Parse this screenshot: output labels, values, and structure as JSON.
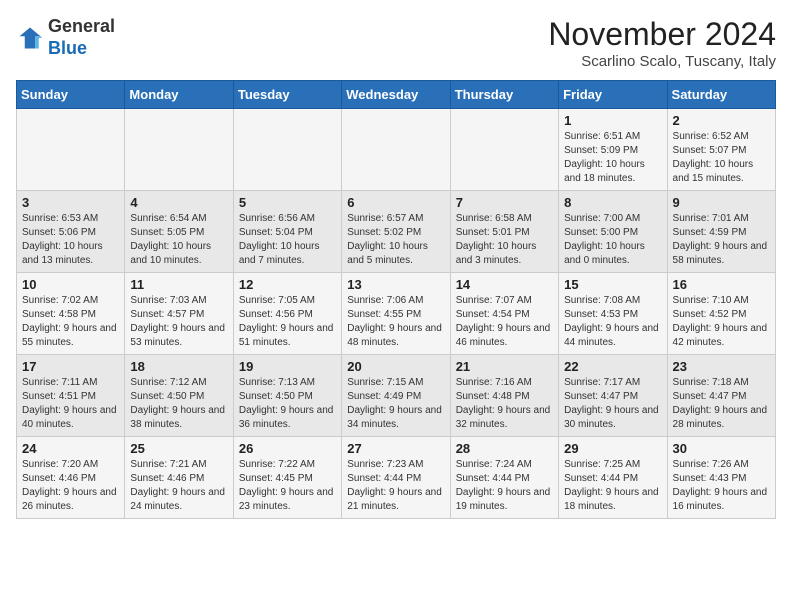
{
  "logo": {
    "general": "General",
    "blue": "Blue"
  },
  "title": "November 2024",
  "location": "Scarlino Scalo, Tuscany, Italy",
  "days_of_week": [
    "Sunday",
    "Monday",
    "Tuesday",
    "Wednesday",
    "Thursday",
    "Friday",
    "Saturday"
  ],
  "weeks": [
    [
      {
        "day": "",
        "sunrise": "",
        "sunset": "",
        "daylight": ""
      },
      {
        "day": "",
        "sunrise": "",
        "sunset": "",
        "daylight": ""
      },
      {
        "day": "",
        "sunrise": "",
        "sunset": "",
        "daylight": ""
      },
      {
        "day": "",
        "sunrise": "",
        "sunset": "",
        "daylight": ""
      },
      {
        "day": "",
        "sunrise": "",
        "sunset": "",
        "daylight": ""
      },
      {
        "day": "1",
        "sunrise": "Sunrise: 6:51 AM",
        "sunset": "Sunset: 5:09 PM",
        "daylight": "Daylight: 10 hours and 18 minutes."
      },
      {
        "day": "2",
        "sunrise": "Sunrise: 6:52 AM",
        "sunset": "Sunset: 5:07 PM",
        "daylight": "Daylight: 10 hours and 15 minutes."
      }
    ],
    [
      {
        "day": "3",
        "sunrise": "Sunrise: 6:53 AM",
        "sunset": "Sunset: 5:06 PM",
        "daylight": "Daylight: 10 hours and 13 minutes."
      },
      {
        "day": "4",
        "sunrise": "Sunrise: 6:54 AM",
        "sunset": "Sunset: 5:05 PM",
        "daylight": "Daylight: 10 hours and 10 minutes."
      },
      {
        "day": "5",
        "sunrise": "Sunrise: 6:56 AM",
        "sunset": "Sunset: 5:04 PM",
        "daylight": "Daylight: 10 hours and 7 minutes."
      },
      {
        "day": "6",
        "sunrise": "Sunrise: 6:57 AM",
        "sunset": "Sunset: 5:02 PM",
        "daylight": "Daylight: 10 hours and 5 minutes."
      },
      {
        "day": "7",
        "sunrise": "Sunrise: 6:58 AM",
        "sunset": "Sunset: 5:01 PM",
        "daylight": "Daylight: 10 hours and 3 minutes."
      },
      {
        "day": "8",
        "sunrise": "Sunrise: 7:00 AM",
        "sunset": "Sunset: 5:00 PM",
        "daylight": "Daylight: 10 hours and 0 minutes."
      },
      {
        "day": "9",
        "sunrise": "Sunrise: 7:01 AM",
        "sunset": "Sunset: 4:59 PM",
        "daylight": "Daylight: 9 hours and 58 minutes."
      }
    ],
    [
      {
        "day": "10",
        "sunrise": "Sunrise: 7:02 AM",
        "sunset": "Sunset: 4:58 PM",
        "daylight": "Daylight: 9 hours and 55 minutes."
      },
      {
        "day": "11",
        "sunrise": "Sunrise: 7:03 AM",
        "sunset": "Sunset: 4:57 PM",
        "daylight": "Daylight: 9 hours and 53 minutes."
      },
      {
        "day": "12",
        "sunrise": "Sunrise: 7:05 AM",
        "sunset": "Sunset: 4:56 PM",
        "daylight": "Daylight: 9 hours and 51 minutes."
      },
      {
        "day": "13",
        "sunrise": "Sunrise: 7:06 AM",
        "sunset": "Sunset: 4:55 PM",
        "daylight": "Daylight: 9 hours and 48 minutes."
      },
      {
        "day": "14",
        "sunrise": "Sunrise: 7:07 AM",
        "sunset": "Sunset: 4:54 PM",
        "daylight": "Daylight: 9 hours and 46 minutes."
      },
      {
        "day": "15",
        "sunrise": "Sunrise: 7:08 AM",
        "sunset": "Sunset: 4:53 PM",
        "daylight": "Daylight: 9 hours and 44 minutes."
      },
      {
        "day": "16",
        "sunrise": "Sunrise: 7:10 AM",
        "sunset": "Sunset: 4:52 PM",
        "daylight": "Daylight: 9 hours and 42 minutes."
      }
    ],
    [
      {
        "day": "17",
        "sunrise": "Sunrise: 7:11 AM",
        "sunset": "Sunset: 4:51 PM",
        "daylight": "Daylight: 9 hours and 40 minutes."
      },
      {
        "day": "18",
        "sunrise": "Sunrise: 7:12 AM",
        "sunset": "Sunset: 4:50 PM",
        "daylight": "Daylight: 9 hours and 38 minutes."
      },
      {
        "day": "19",
        "sunrise": "Sunrise: 7:13 AM",
        "sunset": "Sunset: 4:50 PM",
        "daylight": "Daylight: 9 hours and 36 minutes."
      },
      {
        "day": "20",
        "sunrise": "Sunrise: 7:15 AM",
        "sunset": "Sunset: 4:49 PM",
        "daylight": "Daylight: 9 hours and 34 minutes."
      },
      {
        "day": "21",
        "sunrise": "Sunrise: 7:16 AM",
        "sunset": "Sunset: 4:48 PM",
        "daylight": "Daylight: 9 hours and 32 minutes."
      },
      {
        "day": "22",
        "sunrise": "Sunrise: 7:17 AM",
        "sunset": "Sunset: 4:47 PM",
        "daylight": "Daylight: 9 hours and 30 minutes."
      },
      {
        "day": "23",
        "sunrise": "Sunrise: 7:18 AM",
        "sunset": "Sunset: 4:47 PM",
        "daylight": "Daylight: 9 hours and 28 minutes."
      }
    ],
    [
      {
        "day": "24",
        "sunrise": "Sunrise: 7:20 AM",
        "sunset": "Sunset: 4:46 PM",
        "daylight": "Daylight: 9 hours and 26 minutes."
      },
      {
        "day": "25",
        "sunrise": "Sunrise: 7:21 AM",
        "sunset": "Sunset: 4:46 PM",
        "daylight": "Daylight: 9 hours and 24 minutes."
      },
      {
        "day": "26",
        "sunrise": "Sunrise: 7:22 AM",
        "sunset": "Sunset: 4:45 PM",
        "daylight": "Daylight: 9 hours and 23 minutes."
      },
      {
        "day": "27",
        "sunrise": "Sunrise: 7:23 AM",
        "sunset": "Sunset: 4:44 PM",
        "daylight": "Daylight: 9 hours and 21 minutes."
      },
      {
        "day": "28",
        "sunrise": "Sunrise: 7:24 AM",
        "sunset": "Sunset: 4:44 PM",
        "daylight": "Daylight: 9 hours and 19 minutes."
      },
      {
        "day": "29",
        "sunrise": "Sunrise: 7:25 AM",
        "sunset": "Sunset: 4:44 PM",
        "daylight": "Daylight: 9 hours and 18 minutes."
      },
      {
        "day": "30",
        "sunrise": "Sunrise: 7:26 AM",
        "sunset": "Sunset: 4:43 PM",
        "daylight": "Daylight: 9 hours and 16 minutes."
      }
    ]
  ]
}
